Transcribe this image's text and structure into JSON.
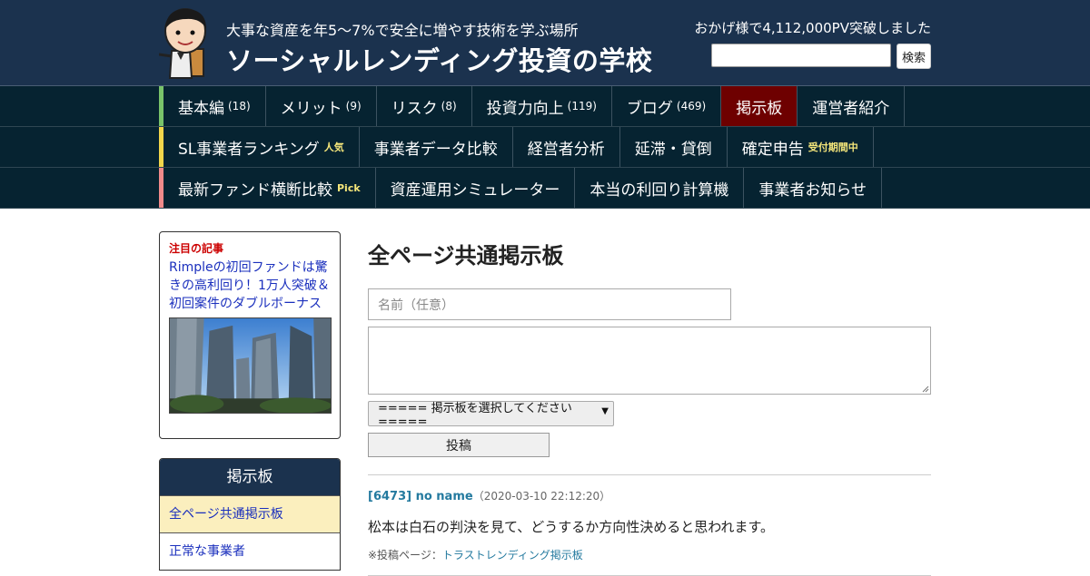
{
  "header": {
    "tagline": "大事な資産を年5～7%で安全に増やす技術を学ぶ場所",
    "site_title": "ソーシャルレンディング投資の学校",
    "pv_text": "おかげ様で4,112,000PV突破しました",
    "search_value": "",
    "search_button": "検索"
  },
  "nav": {
    "rows": [
      {
        "bar_color": "#79c36a",
        "items": [
          {
            "label": "基本編",
            "count": "(18)"
          },
          {
            "label": "メリット",
            "count": "(9)"
          },
          {
            "label": "リスク",
            "count": "(8)"
          },
          {
            "label": "投資力向上",
            "count": "(119)"
          },
          {
            "label": "ブログ",
            "count": "(469)"
          },
          {
            "label": "掲示板",
            "active": true
          },
          {
            "label": "運営者紹介"
          }
        ]
      },
      {
        "bar_color": "#f2d64b",
        "items": [
          {
            "label": "SL事業者ランキング",
            "tag": "人気"
          },
          {
            "label": "事業者データ比較"
          },
          {
            "label": "経営者分析"
          },
          {
            "label": "延滞・貸倒"
          },
          {
            "label": "確定申告",
            "tag": "受付期間中"
          }
        ]
      },
      {
        "bar_color": "#f08a8a",
        "items": [
          {
            "label": "最新ファンド横断比較",
            "tag": "Pick"
          },
          {
            "label": "資産運用シミュレーター"
          },
          {
            "label": "本当の利回り計算機"
          },
          {
            "label": "事業者お知らせ"
          }
        ]
      }
    ]
  },
  "sidebar": {
    "featured_label": "注目の記事",
    "featured_title": "Rimpleの初回ファンドは驚きの高利回り！1万人突破＆初回案件のダブルボーナス",
    "board_heading": "掲示板",
    "board_items": [
      "全ページ共通掲示板",
      "正常な事業者"
    ]
  },
  "main": {
    "title": "全ページ共通掲示板",
    "name_placeholder": "名前（任意）",
    "body_value": "",
    "select_value": "===== 掲示板を選択してください =====",
    "submit_label": "投稿",
    "post": {
      "author": "[6473] no name",
      "date": "（2020-03-10 22:12:20）",
      "body": "松本は白石の判決を見て、どうするか方向性決めると思われます。",
      "source_prefix": "※投稿ページ：",
      "source_link": "トラストレンディング掲示板"
    }
  },
  "colors": {
    "header_bg": "#1b324e",
    "nav_bg": "#062331",
    "active_nav": "#6e0000",
    "link": "#1a2fbd",
    "accent_link": "#247a9f",
    "highlight": "#fbefbe"
  }
}
